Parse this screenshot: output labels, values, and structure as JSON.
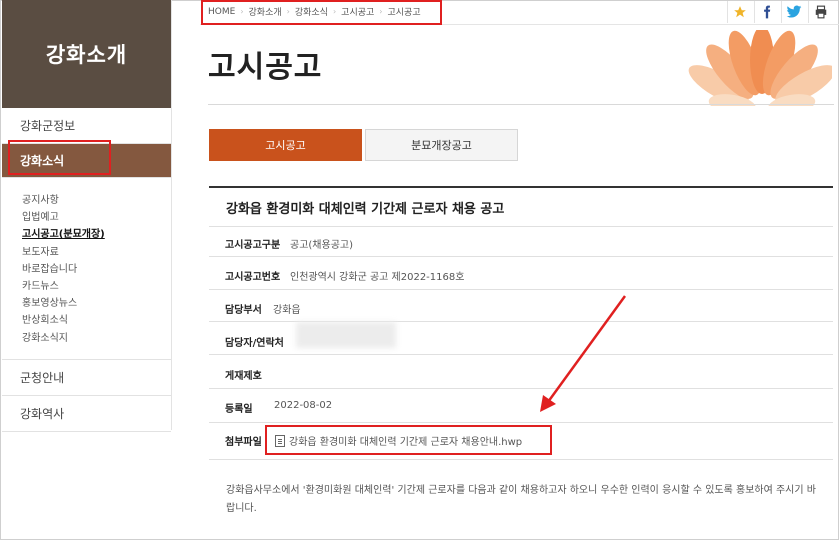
{
  "sidebar": {
    "heading": "강화소개",
    "items": [
      {
        "label": "강화군정보"
      },
      {
        "label": "강화소식"
      }
    ],
    "sub_items": [
      {
        "label": "공지사항"
      },
      {
        "label": "입법예고"
      },
      {
        "label": "고시공고(분묘개장)"
      },
      {
        "label": "보도자료"
      },
      {
        "label": "바로잡습니다"
      },
      {
        "label": "카드뉴스"
      },
      {
        "label": "홍보영상뉴스"
      },
      {
        "label": "반상회소식"
      },
      {
        "label": "강화소식지"
      }
    ],
    "bottom_items": [
      {
        "label": "군청안내"
      },
      {
        "label": "강화역사"
      }
    ]
  },
  "breadcrumb": [
    "HOME",
    "강화소개",
    "강화소식",
    "고시공고",
    "고시공고"
  ],
  "top_icons": [
    "star-icon",
    "facebook-icon",
    "twitter-icon",
    "print-icon"
  ],
  "page": {
    "title": "고시공고",
    "tabs": [
      {
        "label": "고시공고",
        "active": true
      },
      {
        "label": "분묘개장공고",
        "active": false
      }
    ]
  },
  "notice": {
    "title": "강화읍 환경미화 대체인력 기간제 근로자 채용 공고",
    "fields": [
      {
        "label": "고시공고구분",
        "value": "공고(채용공고)"
      },
      {
        "label": "고시공고번호",
        "value": "인천광역시 강화군 공고 제2022-1168호"
      },
      {
        "label": "담당부서",
        "value": "강화읍"
      },
      {
        "label": "담당자/연락처",
        "value": ""
      },
      {
        "label": "게재제호",
        "value": ""
      },
      {
        "label": "등록일",
        "value": "2022-08-02"
      },
      {
        "label": "첨부파일",
        "value": "강화읍 환경미화 대체인력 기간제 근로자 채용안내.hwp"
      }
    ],
    "body": "강화읍사무소에서 '환경미화원 대체인력' 기간제 근로자를 다음과 같이 채용하고자 하오니 우수한 인력이 응시할 수 있도록 홍보하여 주시기 바랍니다."
  },
  "colors": {
    "sidebar_header": "#5a4d42",
    "sidebar_active": "#84583f",
    "tab_active": "#c9521c",
    "highlight": "#e02020"
  }
}
